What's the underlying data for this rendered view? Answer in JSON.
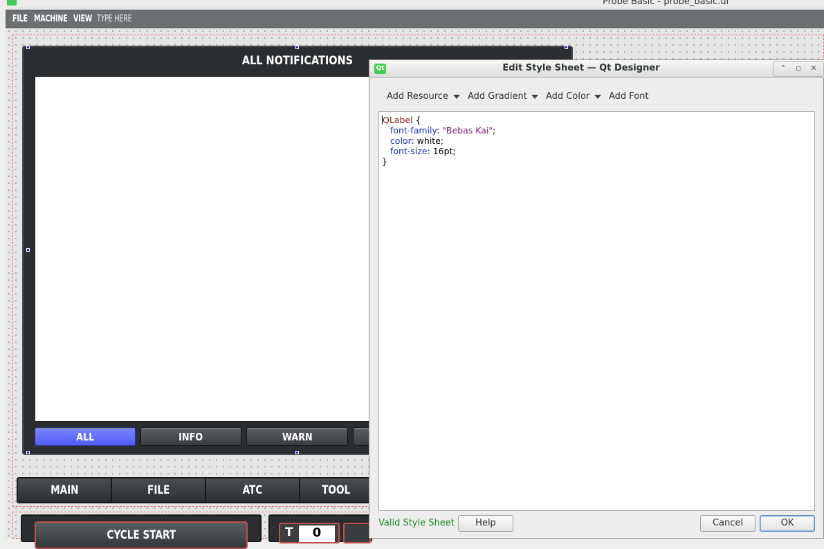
{
  "window": {
    "title": "Probe Basic - probe_basic.ui"
  },
  "menubar": {
    "items": [
      "FILE",
      "MACHINE",
      "VIEW"
    ],
    "type_here": "TYPE HERE"
  },
  "notifications": {
    "title": "ALL NOTIFICATIONS",
    "filters": [
      {
        "label": "ALL",
        "active": true
      },
      {
        "label": "INFO",
        "active": false
      },
      {
        "label": "WARN",
        "active": false
      }
    ]
  },
  "nav_tabs": [
    "MAIN",
    "FILE",
    "ATC",
    "TOOL"
  ],
  "bottom": {
    "cycle_start": "CYCLE START",
    "t_label": "T",
    "t_value": "0"
  },
  "dialog": {
    "title": "Edit Style Sheet — Qt Designer",
    "icon": "Qt",
    "toolbar": {
      "add_resource": "Add Resource",
      "add_gradient": "Add Gradient",
      "add_color": "Add Color",
      "add_font": "Add Font"
    },
    "code": {
      "selector": "QLabel",
      "open": "{",
      "close": "}",
      "props": [
        {
          "name": "font-family",
          "value": "\"Bebas Kai\"",
          "is_string": true
        },
        {
          "name": "color",
          "value": "white",
          "is_string": false
        },
        {
          "name": "font-size",
          "value": "16pt",
          "is_string": false
        }
      ]
    },
    "status": "Valid Style Sheet",
    "buttons": {
      "help": "Help",
      "cancel": "Cancel",
      "ok": "OK"
    },
    "controls": {
      "up": "⌃",
      "restore": "▫",
      "close": "✕"
    }
  },
  "colors": {
    "accent_active_filter": "#5b67f8",
    "dark_panel": "#2b2e31",
    "valid_text": "#1b8a1b",
    "qt_green": "#41cd52"
  }
}
